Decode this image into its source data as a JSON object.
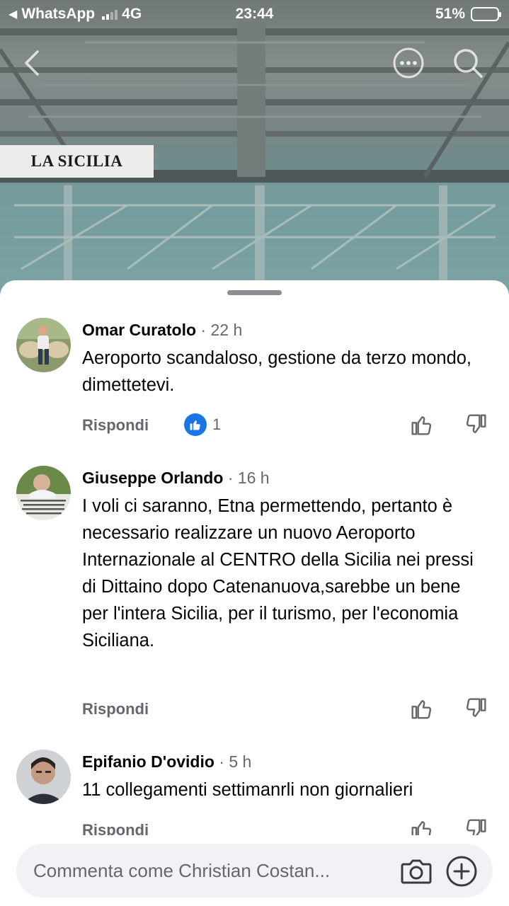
{
  "status_bar": {
    "back_app": "WhatsApp",
    "network": "4G",
    "time": "23:44",
    "battery": "51%",
    "battery_level": 0.51
  },
  "article": {
    "brand": "LA SICILIA"
  },
  "colors": {
    "accent": "#1b74e4",
    "secondary_text": "#65676b",
    "battery": "#f5cc1a"
  },
  "icons": {
    "back": "chevron-left-icon",
    "more": "more-options-icon",
    "search": "search-icon",
    "like": "thumbs-up-icon",
    "dislike": "thumbs-down-icon",
    "camera": "camera-icon",
    "add": "plus-circle-icon"
  },
  "comments": [
    {
      "author": "Omar Curatolo",
      "time": " · 22 h",
      "text": "Aeroporto scandaloso, gestione da terzo mondo, dimettetevi.",
      "reply_label": "Rispondi",
      "like_count": "1"
    },
    {
      "author": "Giuseppe Orlando",
      "time": " · 16 h",
      "text": "I voli ci saranno, Etna permettendo, pertanto è necessario realizzare un nuovo Aeroporto Internazionale al CENTRO della Sicilia nei pressi di Dittaino dopo Catenanuova,sarebbe un bene per l'intera Sicilia, per il turismo, per l'economia Siciliana.",
      "reply_label": "Rispondi"
    },
    {
      "author": "Epifanio D'ovidio",
      "time": " · 5 h",
      "text": "11 collegamenti settimanrli non giornalieri",
      "reply_label": "Rispondi"
    }
  ],
  "composer": {
    "placeholder": "Commenta come Christian Costan..."
  }
}
